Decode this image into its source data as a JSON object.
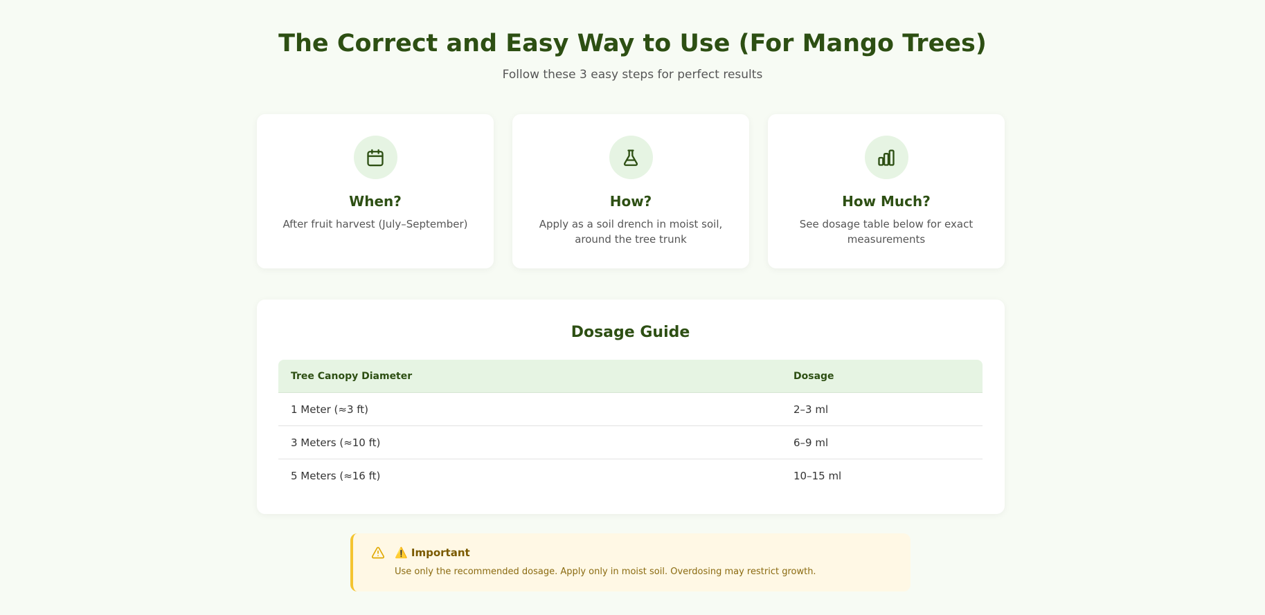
{
  "header": {
    "title": "The Correct and Easy Way to Use (For Mango Trees)",
    "subtitle": "Follow these 3 easy steps for perfect results"
  },
  "steps": [
    {
      "icon": "calendar-icon",
      "title": "When?",
      "description": "After fruit harvest (July–September)"
    },
    {
      "icon": "flask-icon",
      "title": "How?",
      "description": "Apply as a soil drench in moist soil, around the tree trunk"
    },
    {
      "icon": "bar-chart-icon",
      "title": "How Much?",
      "description": "See dosage table below for exact measurements"
    }
  ],
  "dosage": {
    "title": "Dosage Guide",
    "columns": [
      "Tree Canopy Diameter",
      "Dosage"
    ],
    "rows": [
      [
        "1 Meter (≈3 ft)",
        "2–3 ml"
      ],
      [
        "3 Meters (≈10 ft)",
        "6–9 ml"
      ],
      [
        "5 Meters (≈16 ft)",
        "10–15 ml"
      ]
    ]
  },
  "notice": {
    "icon": "warning-icon",
    "title": "⚠️ Important",
    "text": "Use only the recommended dosage. Apply only in moist soil. Overdosing may restrict growth."
  },
  "colors": {
    "heading": "#2d4f13",
    "icon_bg": "#e6f4e3",
    "notice_bg": "#fff8e5",
    "notice_border": "#f4c430"
  }
}
